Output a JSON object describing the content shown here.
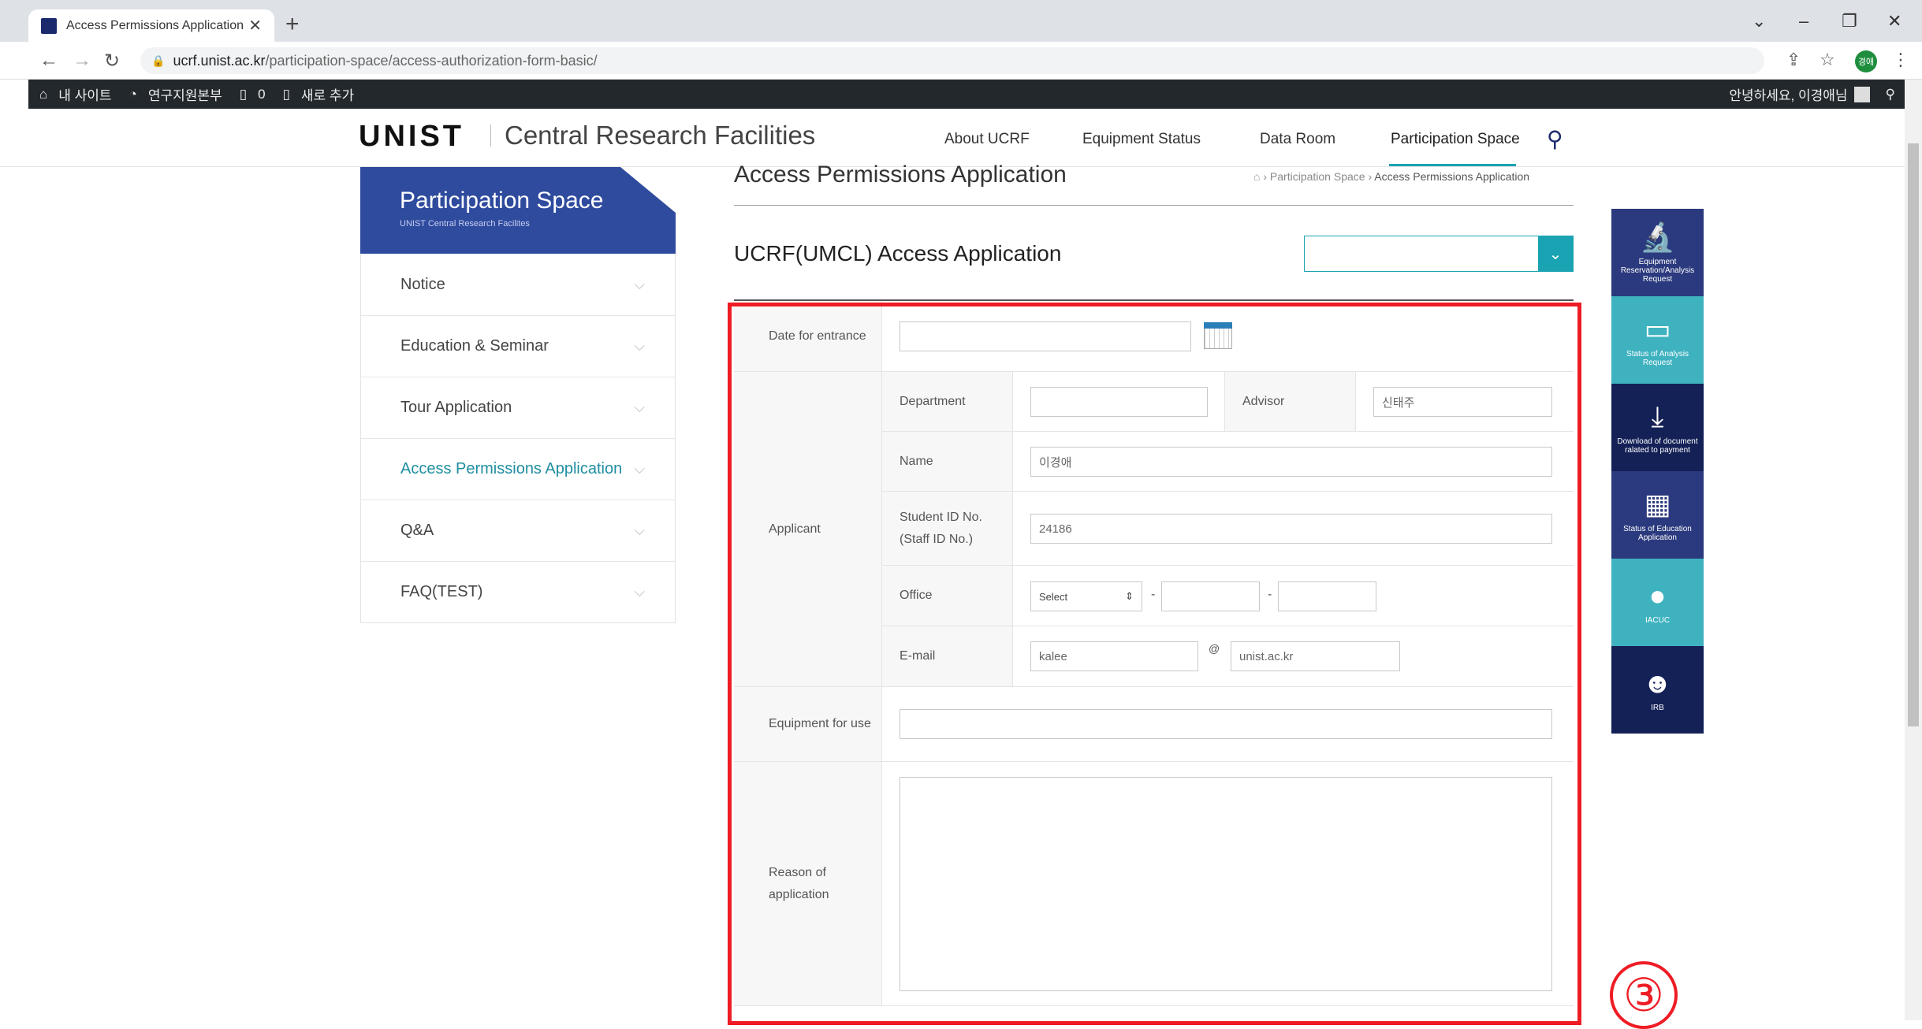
{
  "browser": {
    "tab_title": "Access Permissions Application",
    "url_host": "ucrf.unist.ac.kr",
    "url_path": "/participation-space/access-authorization-form-basic/",
    "profile_initials": "경애"
  },
  "wp_admin_bar": {
    "items": [
      "내 사이트",
      "연구지원본부",
      "0",
      "새로 추가"
    ],
    "greeting": "안녕하세요, 이경애님"
  },
  "header": {
    "logo": "UNIST",
    "site_name": "Central Research Facilities",
    "nav": [
      "About UCRF",
      "Equipment Status",
      "Data Room",
      "Participation Space"
    ]
  },
  "sidebar": {
    "title": "Participation Space",
    "subtitle": "UNIST Central Research Facilites",
    "items": [
      "Notice",
      "Education & Seminar",
      "Tour Application",
      "Access Permissions Application",
      "Q&A",
      "FAQ(TEST)"
    ],
    "active_index": 3
  },
  "main": {
    "page_title": "Access Permissions Application",
    "breadcrumb": [
      "Participation Space",
      "Access Permissions Application"
    ],
    "section_title": "UCRF(UMCL) Access Application",
    "section_select_value": ""
  },
  "form": {
    "date_label": "Date for entrance",
    "date_value": "",
    "applicant_label": "Applicant",
    "department_label": "Department",
    "department_value": "",
    "advisor_label": "Advisor",
    "advisor_value": "신태주",
    "name_label": "Name",
    "name_value": "이경애",
    "student_id_label": "Student ID No. (Staff ID No.)",
    "student_id_value": "24186",
    "office_label": "Office",
    "office_select": "Select",
    "office_dash": "-",
    "office_part2": "",
    "office_part3": "",
    "email_label": "E-mail",
    "email_user": "kalee",
    "email_at": "@",
    "email_domain": "unist.ac.kr",
    "equipment_label": "Equipment for use",
    "equipment_value": "",
    "reason_label": "Reason of application",
    "reason_value": ""
  },
  "quick_menu": [
    {
      "label": "Equipment Reservation/Analysis Request",
      "icon": "🔬",
      "color": "#2b3a7e"
    },
    {
      "label": "Status of Analysis Request",
      "icon": "▭",
      "color": "#3fb2c0"
    },
    {
      "label": "Download of document ralated to payment",
      "icon": "⤓",
      "color": "#142157"
    },
    {
      "label": "Status of Education Application",
      "icon": "▦",
      "color": "#2b3a7e"
    },
    {
      "label": "IACUC",
      "icon": "●",
      "color": "#3fb2c0"
    },
    {
      "label": "IRB",
      "icon": "☻",
      "color": "#142157"
    }
  ],
  "annotation": "③",
  "colors": {
    "accent": "#1aa3b2",
    "brand": "#2f4b9e",
    "highlight": "#ee1c24"
  }
}
